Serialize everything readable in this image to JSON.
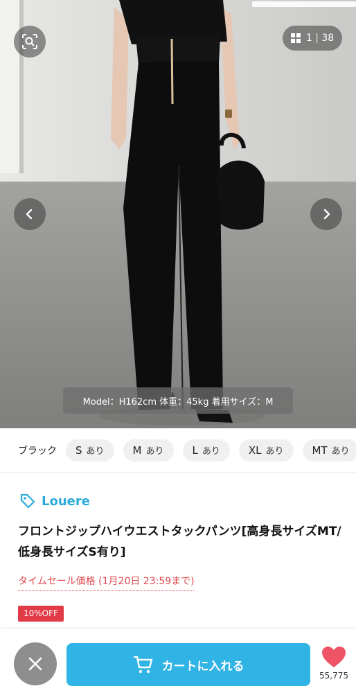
{
  "gallery": {
    "counter_current": "1",
    "counter_separator": "|",
    "counter_total": "38",
    "caption": "Model：H162cm 体重：45kg 着用サイズ：M"
  },
  "variants": {
    "color_label": "ブラック",
    "sizes": [
      {
        "label": "S",
        "availability": "あり"
      },
      {
        "label": "M",
        "availability": "あり"
      },
      {
        "label": "L",
        "availability": "あり"
      },
      {
        "label": "XL",
        "availability": "あり"
      },
      {
        "label": "MT",
        "availability": "あり"
      }
    ]
  },
  "product": {
    "brand": "Louere",
    "title": "フロントジップハイウエストタックパンツ[高身長サイズMT/低身長サイズS有り]",
    "sale_text": "タイムセール価格 (1月20日 23:59まで)",
    "discount_badge": "10%OFF"
  },
  "actions": {
    "cart_label": "カートに入れる",
    "favorite_count": "55,775"
  },
  "colors": {
    "brand_blue": "#2aaad8",
    "cart_button": "#30b3e5",
    "sale_red": "#e0484d",
    "badge_red": "#e23a47",
    "heart_pink": "#ef5466"
  }
}
